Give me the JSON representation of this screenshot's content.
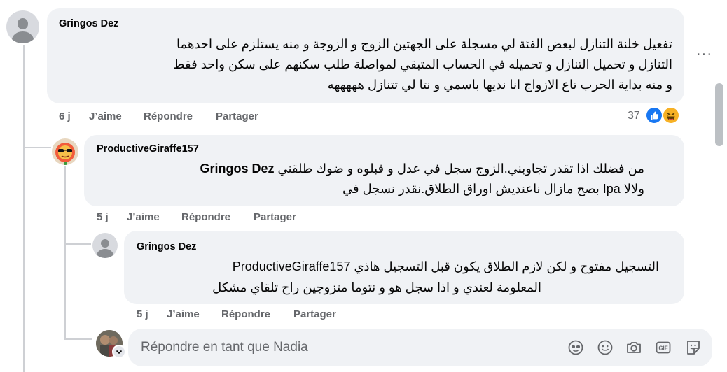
{
  "comments": [
    {
      "author": "Gringos Dez",
      "lines": [
        "تفعيل خلنة التنازل لبعض الفئة لي مسجلة على الجهتين الزوج و الزوجة و منه يستلزم على احدهما",
        "التنازل و تحميل التنازل و تحميله في الحساب المتبقي لمواصلة طلب سكنهم على سكن واحد فقط",
        "و منه بداية الحرب تاع الازواج انا نديها باسمي و نتا لي تتنازل هههههه"
      ],
      "time": "6 j",
      "like": "J’aime",
      "reply": "Répondre",
      "share": "Partager",
      "reaction_count": "37"
    },
    {
      "author": "ProductiveGiraffe157",
      "line1_text": "من فضلك اذا تقدر تجاوبني.الزوج سجل في عدل و قبلوه و ضوك طلقني",
      "line1_mention": "Gringos Dez",
      "line2": "ولالا Ipa بصح مازال ناعنديش اوراق الطلاق.نقدر نسجل في",
      "time": "5 j",
      "like": "J’aime",
      "reply": "Répondre",
      "share": "Partager"
    },
    {
      "author": "Gringos Dez",
      "line1": "التسجيل مفتوح و لكن لازم الطلاق يكون قبل التسجيل هاذي ProductiveGiraffe157",
      "line2": "المعلومة لعندي و اذا سجل هو و نتوما متزوجين راح تلقاي مشكل",
      "time": "5 j",
      "like": "J’aime",
      "reply": "Répondre",
      "share": "Partager"
    }
  ],
  "reply_box": {
    "placeholder": "Répondre en tant que Nadia"
  },
  "more_label": "···",
  "colors": {
    "like_blue": "#1877f2",
    "haha_yellow": "#f7b125",
    "bubble_bg": "#f0f2f5",
    "meta_gray": "#65676b"
  }
}
